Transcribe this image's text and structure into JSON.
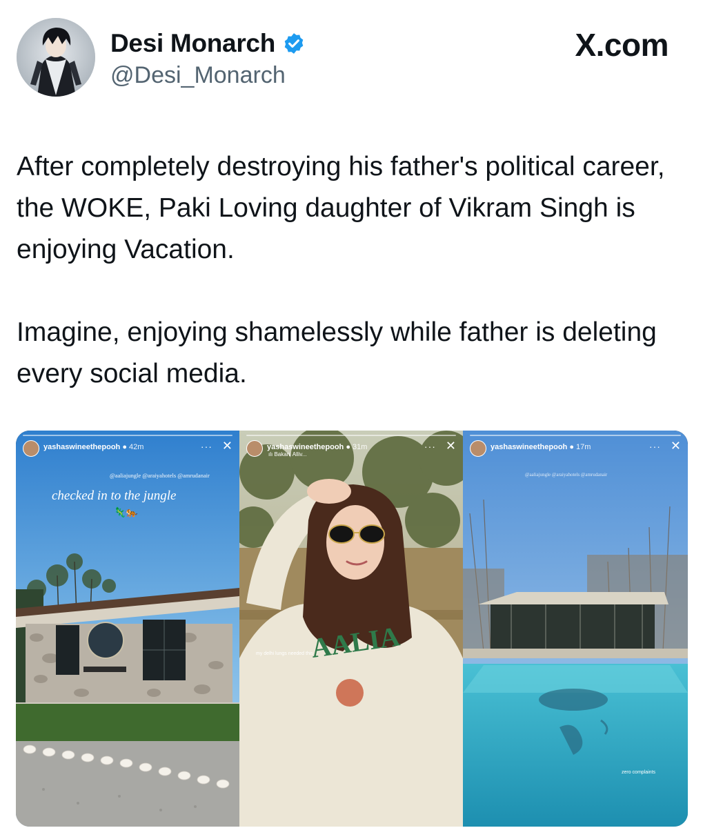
{
  "author": {
    "name": "Desi Monarch",
    "handle": "@Desi_Monarch",
    "verified": true,
    "badge_color": "#1d9bf0"
  },
  "brand": "X.com",
  "tweet": {
    "paragraphs": [
      "After completely destroying his father's political career, the WOKE, Paki Loving daughter of Vikram Singh is enjoying Vacation.",
      "Imagine, enjoying shamelessly while father is deleting every social media."
    ]
  },
  "stories": [
    {
      "username": "yashaswineethepooh",
      "time": "42m",
      "mentions": "@aaliajungle @araiyahotels @amrudanair",
      "caption": "checked in to the jungle",
      "emoji": "🦎🐅"
    },
    {
      "username": "yashaswineethepooh",
      "time": "31m",
      "location": "Bakani Alliv...",
      "caption": "my delhi lungs needed this"
    },
    {
      "username": "yashaswineethepooh",
      "time": "17m",
      "mentions": "@aaliajungle @araiyahotels @amrudanair",
      "caption": "zero complaints"
    }
  ],
  "colors": {
    "text": "#0f1419",
    "secondary": "#536471",
    "accent": "#1d9bf0"
  }
}
